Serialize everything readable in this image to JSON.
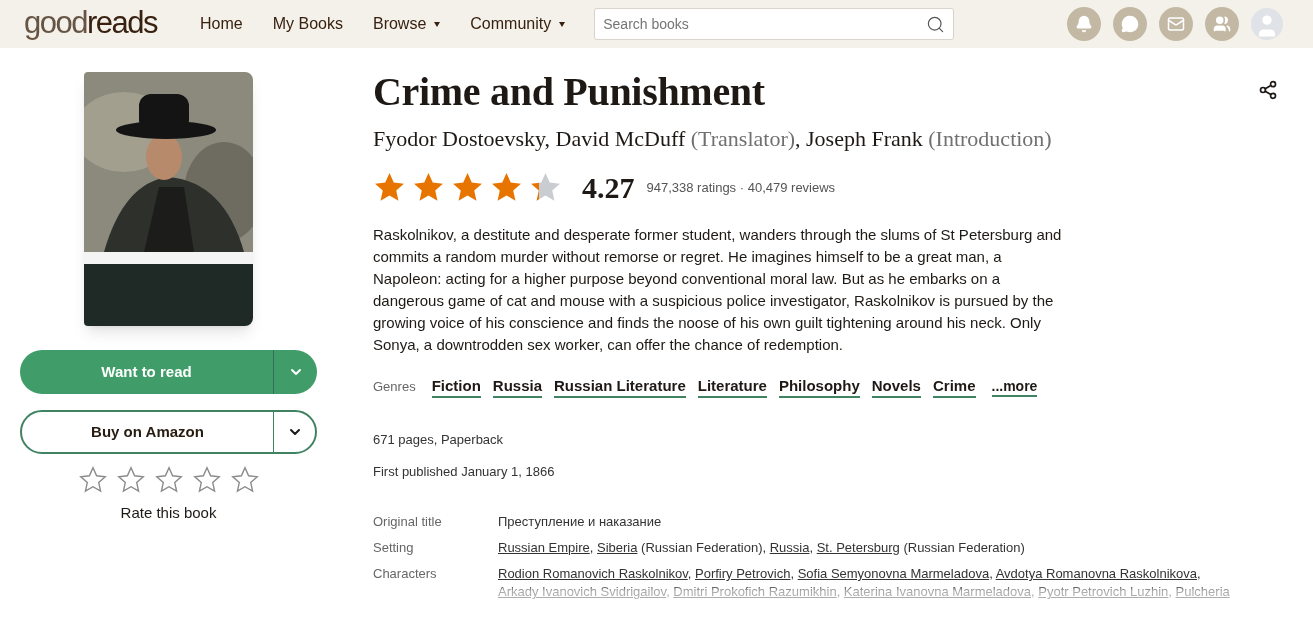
{
  "header": {
    "logo": {
      "light": "good",
      "bold": "reads"
    },
    "nav": [
      {
        "label": "Home",
        "dropdown": false
      },
      {
        "label": "My Books",
        "dropdown": false
      },
      {
        "label": "Browse",
        "dropdown": true
      },
      {
        "label": "Community",
        "dropdown": true
      }
    ],
    "search": {
      "placeholder": "Search books"
    }
  },
  "sidebar": {
    "primary_button": "Want to read",
    "secondary_button": "Buy on Amazon",
    "rating": {
      "stars": 0,
      "label": "Rate this book"
    }
  },
  "book": {
    "title": "Crime and Punishment",
    "authors": [
      {
        "name": "Fyodor Dostoevsky",
        "sep": ", "
      },
      {
        "name": "David McDuff",
        "role": "(Translator)",
        "sep": ", "
      },
      {
        "name": "Joseph Frank",
        "role": "(Introduction)"
      }
    ],
    "rating": {
      "stars": 4.27,
      "value": "4.27",
      "counts": "947,338 ratings · 40,479 reviews"
    },
    "description": "Raskolnikov, a destitute and desperate former student, wanders through the slums of St Petersburg and commits a random murder without remorse or regret. He imagines himself to be a great man, a Napoleon: acting for a higher purpose beyond conventional moral law. But as he embarks on a dangerous game of cat and mouse with a suspicious police investigator, Raskolnikov is pursued by the growing voice of his conscience and finds the noose of his own guilt tightening around his neck. Only Sonya, a downtrodden sex worker, can offer the chance of redemption.",
    "genres_label": "Genres",
    "genres": [
      "Fiction",
      "Russia",
      "Russian Literature",
      "Literature",
      "Philosophy",
      "Novels",
      "Crime"
    ],
    "genres_more": "...more",
    "format": "671 pages, Paperback",
    "published": "First published January 1, 1866",
    "details": [
      {
        "label": "Original title",
        "parts": [
          {
            "text": "Преступление и наказание",
            "link": false
          }
        ]
      },
      {
        "label": "Setting",
        "parts": [
          {
            "text": "Russian Empire",
            "link": true
          },
          {
            "text": ", ",
            "link": false
          },
          {
            "text": "Siberia",
            "link": true
          },
          {
            "text": " (Russian Federation), ",
            "link": false
          },
          {
            "text": "Russia",
            "link": true
          },
          {
            "text": ", ",
            "link": false
          },
          {
            "text": "St. Petersburg",
            "link": true
          },
          {
            "text": " (Russian Federation)",
            "link": false
          }
        ]
      },
      {
        "label": "Characters",
        "parts": [
          {
            "text": "Rodion Romanovich Raskolnikov",
            "link": true
          },
          {
            "text": ", ",
            "link": false
          },
          {
            "text": "Porfiry Petrovich",
            "link": true
          },
          {
            "text": ", ",
            "link": false
          },
          {
            "text": "Sofia Semyonovna Marmeladova",
            "link": true
          },
          {
            "text": ", ",
            "link": false
          },
          {
            "text": "Avdotya Romanovna Raskolnikova",
            "link": true
          },
          {
            "text": ", ",
            "link": false
          },
          {
            "text": "Arkady Ivanovich Svidrigailov",
            "link": true
          },
          {
            "text": ", ",
            "link": false
          },
          {
            "text": "Dmitri Prokofich Razumikhin",
            "link": true
          },
          {
            "text": ", ",
            "link": false
          },
          {
            "text": "Katerina Ivanovna Marmeladova",
            "link": true
          },
          {
            "text": ", ",
            "link": false
          },
          {
            "text": "Pyotr Petrovich Luzhin",
            "link": true
          },
          {
            "text": ", ",
            "link": false
          },
          {
            "text": "Pulcheria",
            "link": true
          }
        ]
      }
    ]
  }
}
